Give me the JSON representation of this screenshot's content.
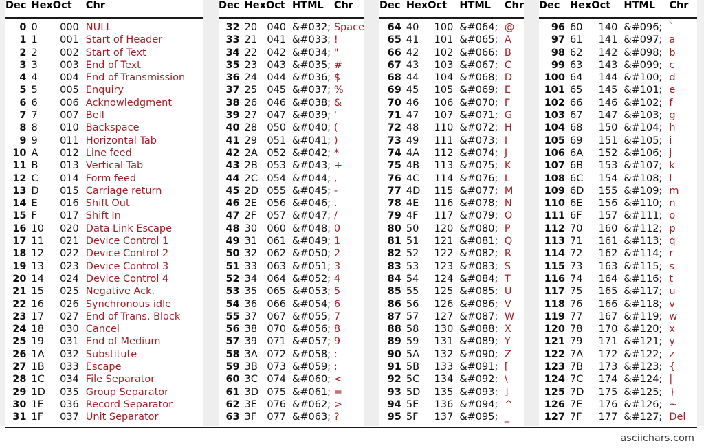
{
  "page": {
    "footer_text": "asciichars.com",
    "accent_color": "#a02128",
    "text_color": "#111111",
    "gutter_color": "#eeeeee",
    "rule_color": "#1a1a1a"
  },
  "groups": [
    {
      "name": "control-characters",
      "headers": [
        "Dec",
        "Hex",
        "Oct",
        "Chr"
      ],
      "has_html_column": false,
      "rows": [
        [
          "0",
          "0",
          "000",
          "NULL"
        ],
        [
          "1",
          "1",
          "001",
          "Start of Header"
        ],
        [
          "2",
          "2",
          "002",
          "Start of Text"
        ],
        [
          "3",
          "3",
          "003",
          "End of Text"
        ],
        [
          "4",
          "4",
          "004",
          "End of Transmission"
        ],
        [
          "5",
          "5",
          "005",
          "Enquiry"
        ],
        [
          "6",
          "6",
          "006",
          "Acknowledgment"
        ],
        [
          "7",
          "7",
          "007",
          "Bell"
        ],
        [
          "8",
          "8",
          "010",
          "Backspace"
        ],
        [
          "9",
          "9",
          "011",
          "Horizontal Tab"
        ],
        [
          "10",
          "A",
          "012",
          "Line feed"
        ],
        [
          "11",
          "B",
          "013",
          "Vertical Tab"
        ],
        [
          "12",
          "C",
          "014",
          "Form feed"
        ],
        [
          "13",
          "D",
          "015",
          "Carriage return"
        ],
        [
          "14",
          "E",
          "016",
          "Shift Out"
        ],
        [
          "15",
          "F",
          "017",
          "Shift In"
        ],
        [
          "16",
          "10",
          "020",
          "Data Link Escape"
        ],
        [
          "17",
          "11",
          "021",
          "Device Control 1"
        ],
        [
          "18",
          "12",
          "022",
          "Device Control 2"
        ],
        [
          "19",
          "13",
          "023",
          "Device Control 3"
        ],
        [
          "20",
          "14",
          "024",
          "Device Control 4"
        ],
        [
          "21",
          "15",
          "025",
          "Negative Ack."
        ],
        [
          "22",
          "16",
          "026",
          "Synchronous idle"
        ],
        [
          "23",
          "17",
          "027",
          "End of Trans. Block"
        ],
        [
          "24",
          "18",
          "030",
          "Cancel"
        ],
        [
          "25",
          "19",
          "031",
          "End of Medium"
        ],
        [
          "26",
          "1A",
          "032",
          "Substitute"
        ],
        [
          "27",
          "1B",
          "033",
          "Escape"
        ],
        [
          "28",
          "1C",
          "034",
          "File Separator"
        ],
        [
          "29",
          "1D",
          "035",
          "Group Separator"
        ],
        [
          "30",
          "1E",
          "036",
          "Record Separator"
        ],
        [
          "31",
          "1F",
          "037",
          "Unit Separator"
        ]
      ]
    },
    {
      "name": "printable-32-63",
      "headers": [
        "Dec",
        "Hex",
        "Oct",
        "HTML",
        "Chr"
      ],
      "has_html_column": true,
      "rows": [
        [
          "32",
          "20",
          "040",
          "&#032;",
          "Space"
        ],
        [
          "33",
          "21",
          "041",
          "&#033;",
          "!"
        ],
        [
          "34",
          "22",
          "042",
          "&#034;",
          "\""
        ],
        [
          "35",
          "23",
          "043",
          "&#035;",
          "#"
        ],
        [
          "36",
          "24",
          "044",
          "&#036;",
          "$"
        ],
        [
          "37",
          "25",
          "045",
          "&#037;",
          "%"
        ],
        [
          "38",
          "26",
          "046",
          "&#038;",
          "&"
        ],
        [
          "39",
          "27",
          "047",
          "&#039;",
          "'"
        ],
        [
          "40",
          "28",
          "050",
          "&#040;",
          "("
        ],
        [
          "41",
          "29",
          "051",
          "&#041;",
          ")"
        ],
        [
          "42",
          "2A",
          "052",
          "&#042;",
          "*"
        ],
        [
          "43",
          "2B",
          "053",
          "&#043;",
          "+"
        ],
        [
          "44",
          "2C",
          "054",
          "&#044;",
          ","
        ],
        [
          "45",
          "2D",
          "055",
          "&#045;",
          "-"
        ],
        [
          "46",
          "2E",
          "056",
          "&#046;",
          "."
        ],
        [
          "47",
          "2F",
          "057",
          "&#047;",
          "/"
        ],
        [
          "48",
          "30",
          "060",
          "&#048;",
          "0"
        ],
        [
          "49",
          "31",
          "061",
          "&#049;",
          "1"
        ],
        [
          "50",
          "32",
          "062",
          "&#050;",
          "2"
        ],
        [
          "51",
          "33",
          "063",
          "&#051;",
          "3"
        ],
        [
          "52",
          "34",
          "064",
          "&#052;",
          "4"
        ],
        [
          "53",
          "35",
          "065",
          "&#053;",
          "5"
        ],
        [
          "54",
          "36",
          "066",
          "&#054;",
          "6"
        ],
        [
          "55",
          "37",
          "067",
          "&#055;",
          "7"
        ],
        [
          "56",
          "38",
          "070",
          "&#056;",
          "8"
        ],
        [
          "57",
          "39",
          "071",
          "&#057;",
          "9"
        ],
        [
          "58",
          "3A",
          "072",
          "&#058;",
          ":"
        ],
        [
          "59",
          "3B",
          "073",
          "&#059;",
          ";"
        ],
        [
          "60",
          "3C",
          "074",
          "&#060;",
          "<"
        ],
        [
          "61",
          "3D",
          "075",
          "&#061;",
          "="
        ],
        [
          "62",
          "3E",
          "076",
          "&#062;",
          ">"
        ],
        [
          "63",
          "3F",
          "077",
          "&#063;",
          "?"
        ]
      ]
    },
    {
      "name": "printable-64-95",
      "headers": [
        "Dec",
        "Hex",
        "Oct",
        "HTML",
        "Chr"
      ],
      "has_html_column": true,
      "rows": [
        [
          "64",
          "40",
          "100",
          "&#064;",
          "@"
        ],
        [
          "65",
          "41",
          "101",
          "&#065;",
          "A"
        ],
        [
          "66",
          "42",
          "102",
          "&#066;",
          "B"
        ],
        [
          "67",
          "43",
          "103",
          "&#067;",
          "C"
        ],
        [
          "68",
          "44",
          "104",
          "&#068;",
          "D"
        ],
        [
          "69",
          "45",
          "105",
          "&#069;",
          "E"
        ],
        [
          "70",
          "46",
          "106",
          "&#070;",
          "F"
        ],
        [
          "71",
          "47",
          "107",
          "&#071;",
          "G"
        ],
        [
          "72",
          "48",
          "110",
          "&#072;",
          "H"
        ],
        [
          "73",
          "49",
          "111",
          "&#073;",
          "I"
        ],
        [
          "74",
          "4A",
          "112",
          "&#074;",
          "J"
        ],
        [
          "75",
          "4B",
          "113",
          "&#075;",
          "K"
        ],
        [
          "76",
          "4C",
          "114",
          "&#076;",
          "L"
        ],
        [
          "77",
          "4D",
          "115",
          "&#077;",
          "M"
        ],
        [
          "78",
          "4E",
          "116",
          "&#078;",
          "N"
        ],
        [
          "79",
          "4F",
          "117",
          "&#079;",
          "O"
        ],
        [
          "80",
          "50",
          "120",
          "&#080;",
          "P"
        ],
        [
          "81",
          "51",
          "121",
          "&#081;",
          "Q"
        ],
        [
          "82",
          "52",
          "122",
          "&#082;",
          "R"
        ],
        [
          "83",
          "53",
          "123",
          "&#083;",
          "S"
        ],
        [
          "84",
          "54",
          "124",
          "&#084;",
          "T"
        ],
        [
          "85",
          "55",
          "125",
          "&#085;",
          "U"
        ],
        [
          "86",
          "56",
          "126",
          "&#086;",
          "V"
        ],
        [
          "87",
          "57",
          "127",
          "&#087;",
          "W"
        ],
        [
          "88",
          "58",
          "130",
          "&#088;",
          "X"
        ],
        [
          "89",
          "59",
          "131",
          "&#089;",
          "Y"
        ],
        [
          "90",
          "5A",
          "132",
          "&#090;",
          "Z"
        ],
        [
          "91",
          "5B",
          "133",
          "&#091;",
          "["
        ],
        [
          "92",
          "5C",
          "134",
          "&#092;",
          "\\"
        ],
        [
          "93",
          "5D",
          "135",
          "&#093;",
          "]"
        ],
        [
          "94",
          "5E",
          "136",
          "&#094;",
          "^"
        ],
        [
          "95",
          "5F",
          "137",
          "&#095;",
          "_"
        ]
      ]
    },
    {
      "name": "printable-96-127",
      "headers": [
        "Dec",
        "Hex",
        "Oct",
        "HTML",
        "Chr"
      ],
      "has_html_column": true,
      "rows": [
        [
          "96",
          "60",
          "140",
          "&#096;",
          "`"
        ],
        [
          "97",
          "61",
          "141",
          "&#097;",
          "a"
        ],
        [
          "98",
          "62",
          "142",
          "&#098;",
          "b"
        ],
        [
          "99",
          "63",
          "143",
          "&#099;",
          "c"
        ],
        [
          "100",
          "64",
          "144",
          "&#100;",
          "d"
        ],
        [
          "101",
          "65",
          "145",
          "&#101;",
          "e"
        ],
        [
          "102",
          "66",
          "146",
          "&#102;",
          "f"
        ],
        [
          "103",
          "67",
          "147",
          "&#103;",
          "g"
        ],
        [
          "104",
          "68",
          "150",
          "&#104;",
          "h"
        ],
        [
          "105",
          "69",
          "151",
          "&#105;",
          "i"
        ],
        [
          "106",
          "6A",
          "152",
          "&#106;",
          "j"
        ],
        [
          "107",
          "6B",
          "153",
          "&#107;",
          "k"
        ],
        [
          "108",
          "6C",
          "154",
          "&#108;",
          "l"
        ],
        [
          "109",
          "6D",
          "155",
          "&#109;",
          "m"
        ],
        [
          "110",
          "6E",
          "156",
          "&#110;",
          "n"
        ],
        [
          "111",
          "6F",
          "157",
          "&#111;",
          "o"
        ],
        [
          "112",
          "70",
          "160",
          "&#112;",
          "p"
        ],
        [
          "113",
          "71",
          "161",
          "&#113;",
          "q"
        ],
        [
          "114",
          "72",
          "162",
          "&#114;",
          "r"
        ],
        [
          "115",
          "73",
          "163",
          "&#115;",
          "s"
        ],
        [
          "116",
          "74",
          "164",
          "&#116;",
          "t"
        ],
        [
          "117",
          "75",
          "165",
          "&#117;",
          "u"
        ],
        [
          "118",
          "76",
          "166",
          "&#118;",
          "v"
        ],
        [
          "119",
          "77",
          "167",
          "&#119;",
          "w"
        ],
        [
          "120",
          "78",
          "170",
          "&#120;",
          "x"
        ],
        [
          "121",
          "79",
          "171",
          "&#121;",
          "y"
        ],
        [
          "122",
          "7A",
          "172",
          "&#122;",
          "z"
        ],
        [
          "123",
          "7B",
          "173",
          "&#123;",
          "{"
        ],
        [
          "124",
          "7C",
          "174",
          "&#124;",
          "|"
        ],
        [
          "125",
          "7D",
          "175",
          "&#125;",
          "}"
        ],
        [
          "126",
          "7E",
          "176",
          "&#126;",
          "~"
        ],
        [
          "127",
          "7F",
          "177",
          "&#127;",
          "Del"
        ]
      ]
    }
  ]
}
